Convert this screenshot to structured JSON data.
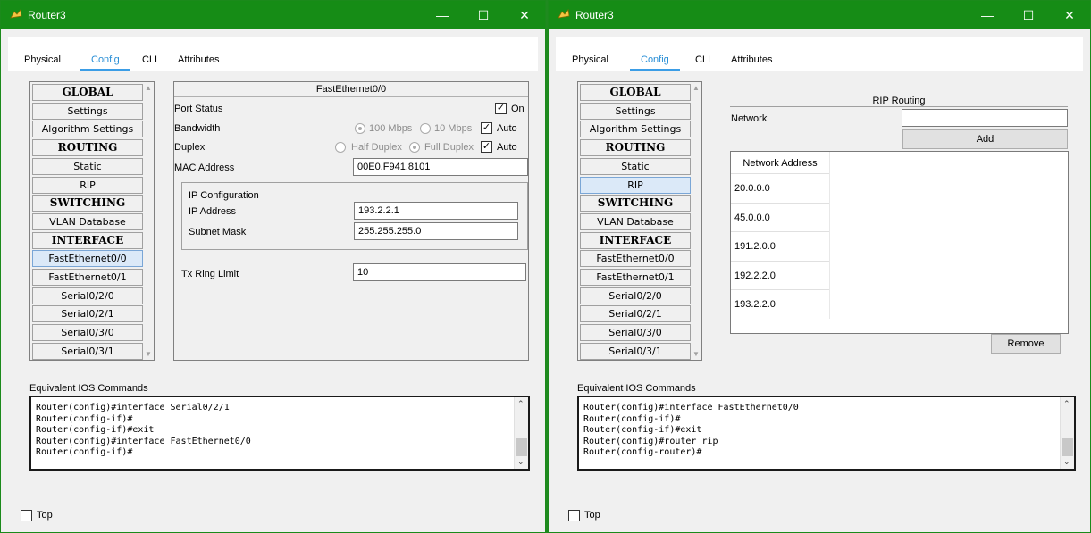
{
  "windows": [
    {
      "title": "Router3",
      "tabs": [
        "Physical",
        "Config",
        "CLI",
        "Attributes"
      ],
      "nav_items": [
        {
          "label": "GLOBAL",
          "header": true
        },
        {
          "label": "Settings"
        },
        {
          "label": "Algorithm Settings"
        },
        {
          "label": "ROUTING",
          "header": true
        },
        {
          "label": "Static"
        },
        {
          "label": "RIP"
        },
        {
          "label": "SWITCHING",
          "header": true
        },
        {
          "label": "VLAN Database"
        },
        {
          "label": "INTERFACE",
          "header": true
        },
        {
          "label": "FastEthernet0/0",
          "selected": true
        },
        {
          "label": "FastEthernet0/1"
        },
        {
          "label": "Serial0/2/0"
        },
        {
          "label": "Serial0/2/1"
        },
        {
          "label": "Serial0/3/0"
        },
        {
          "label": "Serial0/3/1"
        }
      ],
      "interface": {
        "name": "FastEthernet0/0",
        "port_status_label": "Port Status",
        "on_label": "On",
        "bandwidth_label": "Bandwidth",
        "bw_100": "100 Mbps",
        "bw_10": "10 Mbps",
        "auto_label": "Auto",
        "duplex_label": "Duplex",
        "half_duplex": "Half Duplex",
        "full_duplex": "Full Duplex",
        "mac_label": "MAC Address",
        "mac_value": "00E0.F941.8101",
        "ip_config_label": "IP Configuration",
        "ip_label": "IP Address",
        "ip_value": "193.2.2.1",
        "mask_label": "Subnet Mask",
        "mask_value": "255.255.255.0",
        "tx_label": "Tx Ring Limit",
        "tx_value": "10"
      },
      "ios_label": "Equivalent IOS Commands",
      "ios_lines": [
        "Router(config)#interface Serial0/2/1",
        "Router(config-if)#",
        "Router(config-if)#exit",
        "Router(config)#interface FastEthernet0/0",
        "Router(config-if)#"
      ],
      "top_label": "Top"
    },
    {
      "title": "Router3",
      "tabs": [
        "Physical",
        "Config",
        "CLI",
        "Attributes"
      ],
      "nav_items": [
        {
          "label": "GLOBAL",
          "header": true
        },
        {
          "label": "Settings"
        },
        {
          "label": "Algorithm Settings"
        },
        {
          "label": "ROUTING",
          "header": true
        },
        {
          "label": "Static"
        },
        {
          "label": "RIP",
          "selected": true
        },
        {
          "label": "SWITCHING",
          "header": true
        },
        {
          "label": "VLAN Database"
        },
        {
          "label": "INTERFACE",
          "header": true
        },
        {
          "label": "FastEthernet0/0"
        },
        {
          "label": "FastEthernet0/1"
        },
        {
          "label": "Serial0/2/0"
        },
        {
          "label": "Serial0/2/1"
        },
        {
          "label": "Serial0/3/0"
        },
        {
          "label": "Serial0/3/1"
        }
      ],
      "rip": {
        "title": "RIP Routing",
        "network_label": "Network",
        "network_value": "",
        "add_label": "Add",
        "list_header": "Network Address",
        "networks": [
          "20.0.0.0",
          "45.0.0.0",
          "191.2.0.0",
          "192.2.2.0",
          "193.2.2.0"
        ],
        "remove_label": "Remove"
      },
      "ios_label": "Equivalent IOS Commands",
      "ios_lines": [
        "Router(config)#interface FastEthernet0/0",
        "Router(config-if)#",
        "Router(config-if)#exit",
        "Router(config)#router rip",
        "Router(config-router)#"
      ],
      "top_label": "Top"
    }
  ],
  "colors": {
    "titlebar": "#168c16",
    "tab_active": "#2a8fd6",
    "selected_item": "#dbe9f8"
  },
  "icons": {
    "app": "router-app-icon",
    "minimize": "minimize-icon",
    "maximize": "maximize-icon",
    "close": "close-icon"
  }
}
